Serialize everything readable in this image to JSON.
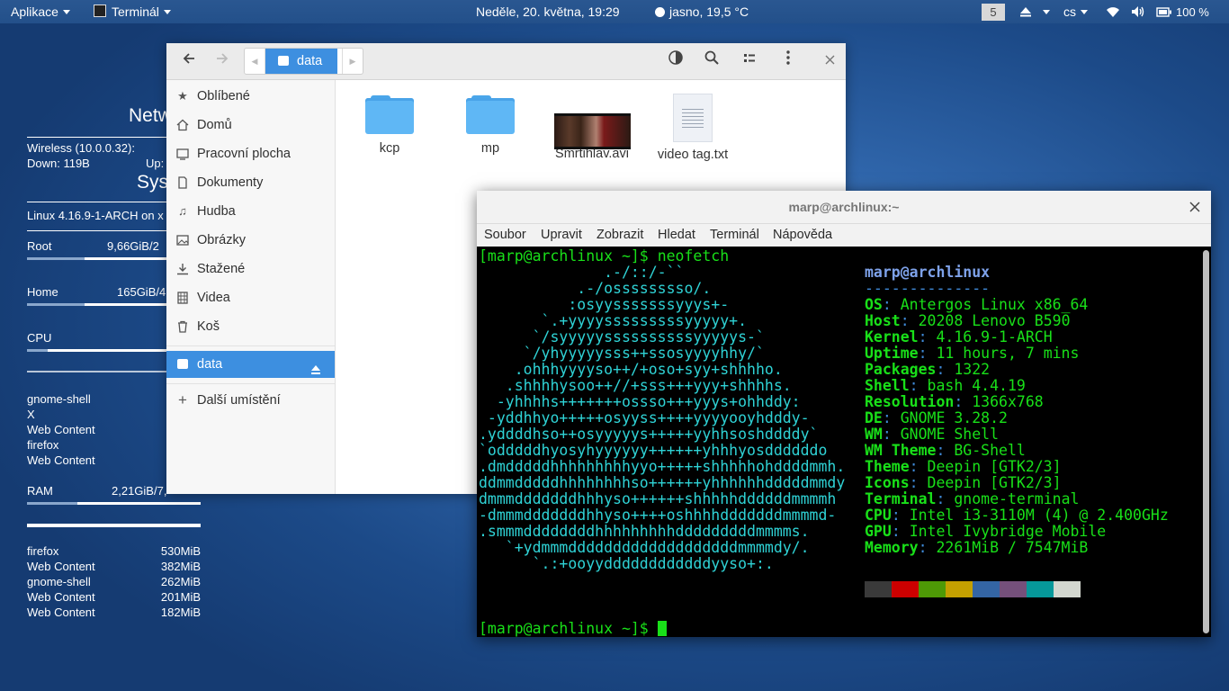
{
  "topbar": {
    "apps": "Aplikace",
    "active_app": "Terminál",
    "clock": "Neděle, 20. května, 19:29",
    "weather": "jasno, 19,5 °C",
    "workspace": "5",
    "lang": "cs",
    "battery": "100 %"
  },
  "conky": {
    "network_title": "Netw",
    "wireless": "Wireless (10.0.0.32):",
    "down": "Down: 119B",
    "up": "Up:",
    "system_title": "Sys",
    "kernel": "Linux 4.16.9-1-ARCH on x",
    "root_label": "Root",
    "root_value": "9,66GiB/2",
    "home_label": "Home",
    "home_value": "165GiB/4",
    "cpu_label": "CPU",
    "cpu_procs": [
      {
        "name": "gnome-shell"
      },
      {
        "name": "X"
      },
      {
        "name": "Web Content"
      },
      {
        "name": "firefox"
      },
      {
        "name": "Web Content"
      }
    ],
    "ram_label": "RAM",
    "ram_value": "2,21GiB/7,",
    "mem_procs": [
      {
        "name": "firefox",
        "value": "530MiB"
      },
      {
        "name": "Web Content",
        "value": "382MiB"
      },
      {
        "name": "gnome-shell",
        "value": "262MiB"
      },
      {
        "name": "Web Content",
        "value": "201MiB"
      },
      {
        "name": "Web Content",
        "value": "182MiB"
      }
    ],
    "root_fraction": 0.33,
    "home_fraction": 0.33,
    "cpu_fraction": 0.12,
    "ram_fraction": 0.29
  },
  "files": {
    "path": "data",
    "sidebar": [
      "Oblíbené",
      "Domů",
      "Pracovní plocha",
      "Dokumenty",
      "Hudba",
      "Obrázky",
      "Stažené",
      "Videa",
      "Koš",
      "data",
      "Další umístění"
    ],
    "items": [
      {
        "name": "kcp",
        "type": "folder"
      },
      {
        "name": "mp",
        "type": "folder"
      },
      {
        "name": "Smrtihlav.avi",
        "type": "video"
      },
      {
        "name": "video tag.txt",
        "type": "text"
      }
    ]
  },
  "terminal": {
    "title": "marp@archlinux:~",
    "menu": [
      "Soubor",
      "Upravit",
      "Zobrazit",
      "Hledat",
      "Terminál",
      "Nápověda"
    ],
    "prompt": "[marp@archlinux ~]$ ",
    "command": "neofetch",
    "user_host": "marp@archlinux",
    "separator": "--------------",
    "logo": [
      "              .-/::/-``",
      "           .-/osssssssso/.",
      "          :osyysssssssyyys+-",
      "       `.+yyyysssssssssyyyyy+.",
      "      `/syyyyyssssssssssyyyyys-`",
      "     `/yhyyyyysss++ssosyyyyhhy/`",
      "    .ohhhyyyyso++/+oso+syy+shhhho.",
      "   .shhhhysoo++//+sss+++yyy+shhhhs.",
      "  -yhhhhs+++++++ossso+++yyys+ohhddy:",
      " -yddhhyo+++++osyyss++++yyyyooyhdddy-",
      ".yddddhso++osyyyyys+++++yyhhsoshddddy`",
      "`odddddhyosyhyyyyyy++++++yhhhyosddddddo",
      ".dmdddddhhhhhhhhhyyo+++++shhhhhohddddmmh.",
      "ddmmdddddhhhhhhhhso++++++yhhhhhhdddddmmdy",
      "dmmmdddddddhhhyso++++++shhhhhddddddmmmmh",
      "-dmmmdddddddhhyso++++oshhhhdddddddmmmmd-",
      ".smmmddddddddhhhhhhhhhdddddddddmmmms.",
      "   `+ydmmmdddddddddddddddddddmmmmdy/.",
      "      `.:+ooyyddddddddddddyyso+:."
    ],
    "info": [
      {
        "key": "OS",
        "value": "Antergos Linux x86_64"
      },
      {
        "key": "Host",
        "value": "20208 Lenovo B590"
      },
      {
        "key": "Kernel",
        "value": "4.16.9-1-ARCH"
      },
      {
        "key": "Uptime",
        "value": "11 hours, 7 mins"
      },
      {
        "key": "Packages",
        "value": "1322"
      },
      {
        "key": "Shell",
        "value": "bash 4.4.19"
      },
      {
        "key": "Resolution",
        "value": "1366x768"
      },
      {
        "key": "DE",
        "value": "GNOME 3.28.2"
      },
      {
        "key": "WM",
        "value": "GNOME Shell"
      },
      {
        "key": "WM Theme",
        "value": "BG-Shell"
      },
      {
        "key": "Theme",
        "value": "Deepin [GTK2/3]"
      },
      {
        "key": "Icons",
        "value": "Deepin [GTK2/3]"
      },
      {
        "key": "Terminal",
        "value": "gnome-terminal"
      },
      {
        "key": "CPU",
        "value": "Intel i3-3110M (4) @ 2.400GHz"
      },
      {
        "key": "GPU",
        "value": "Intel Ivybridge Mobile"
      },
      {
        "key": "Memory",
        "value": "2261MiB / 7547MiB"
      }
    ],
    "palette": [
      "#3a3a3a",
      "#cc0000",
      "#4e9a06",
      "#c4a000",
      "#3465a4",
      "#75507b",
      "#06989a",
      "#d3d7cf"
    ]
  }
}
